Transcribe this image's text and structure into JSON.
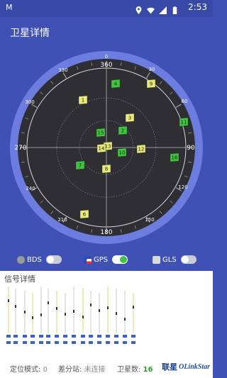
{
  "status_bar": {
    "left_text": "M",
    "time": "2:53",
    "icons": [
      "location-icon",
      "wifi-icon",
      "signal-icon",
      "battery-icon"
    ]
  },
  "header": {
    "title": "卫星详情"
  },
  "sky_view": {
    "bearing_labels": [
      "0",
      "30",
      "60",
      "120",
      "150",
      "210",
      "240",
      "300",
      "330"
    ],
    "cardinal_labels": [
      "360",
      "90",
      "180",
      "270"
    ],
    "satellites": [
      {
        "id": "1",
        "color": "#e8ea79"
      },
      {
        "id": "4",
        "color": "#3ec53e"
      },
      {
        "id": "9",
        "color": "#e8ea79"
      },
      {
        "id": "11",
        "color": "#3ec53e"
      },
      {
        "id": "3",
        "color": "#e8ea79"
      },
      {
        "id": "15",
        "color": "#3ec53e"
      },
      {
        "id": "2",
        "color": "#3ec53e"
      },
      {
        "id": "13",
        "color": "#e8ea79"
      },
      {
        "id": "14",
        "color": "#e8ea79"
      },
      {
        "id": "10",
        "color": "#3ec53e"
      },
      {
        "id": "12",
        "color": "#e8ea79"
      },
      {
        "id": "16",
        "color": "#3ec53e"
      },
      {
        "id": "7",
        "color": "#3ec53e"
      },
      {
        "id": "8",
        "color": "#e8ea79"
      },
      {
        "id": "6",
        "color": "#e8ea79"
      }
    ]
  },
  "constellations": [
    {
      "label": "BDS",
      "enabled": false,
      "icon": "beidou-icon"
    },
    {
      "label": "GPS",
      "enabled": true,
      "icon": "us-flag-icon"
    },
    {
      "label": "GLS",
      "enabled": false,
      "icon": "glonass-icon"
    }
  ],
  "signal_panel": {
    "title": "信号详情"
  },
  "footer": {
    "mode_label": "定位模式:",
    "mode_value": "0",
    "station_label": "差分站:",
    "station_value": "未连接",
    "count_label": "卫星数:",
    "count_value": "16",
    "logo_text": "联星",
    "brand_text": "OLinkStar"
  },
  "colors": {
    "background": "#3f51b5",
    "sky_ring": "#6c7ddf",
    "sky_fill": "#2e2e33",
    "used": "#3ec53e",
    "visible": "#e8ea79"
  }
}
